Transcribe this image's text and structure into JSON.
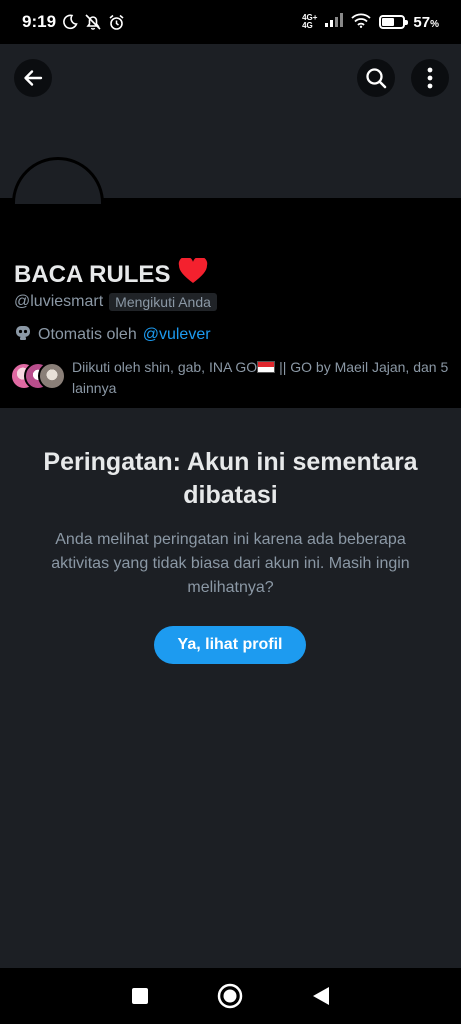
{
  "status_bar": {
    "time": "9:19",
    "net_type_top": "4G+",
    "net_type_bottom": "4G",
    "battery_percent": "57",
    "battery_level": 0.57,
    "percent_sign": "%",
    "icons": [
      "moon-icon",
      "muted-bell-icon",
      "alarm-icon",
      "signal-icon",
      "wifi-icon",
      "battery-icon"
    ]
  },
  "header": {
    "icons": [
      "back-arrow-icon",
      "search-icon",
      "more-vertical-icon"
    ]
  },
  "profile": {
    "display_name": "BACA RULES",
    "name_emoji": "heart-icon",
    "handle": "@luviesmart",
    "follows_you_badge": "Mengikuti Anda",
    "automated_prefix": "Otomatis oleh",
    "automated_by": "@vulever",
    "followed_by_text_part1": "Diikuti oleh shin, gab, INA GO",
    "followed_by_text_part2": "|| GO by Maeil Jajan, dan 5 lainnya"
  },
  "warning": {
    "title": "Peringatan: Akun ini sementara dibatasi",
    "body": "Anda melihat peringatan ini karena ada beberapa aktivitas yang tidak biasa dari akun ini. Masih ingin melihatnya?",
    "button_label": "Ya, lihat profil"
  },
  "colors": {
    "accent": "#1d9bf0",
    "background": "#1c1f24",
    "heart": "#f4212e"
  },
  "nav_bar": {
    "icons": [
      "recent-apps-icon",
      "home-icon",
      "back-icon"
    ]
  }
}
